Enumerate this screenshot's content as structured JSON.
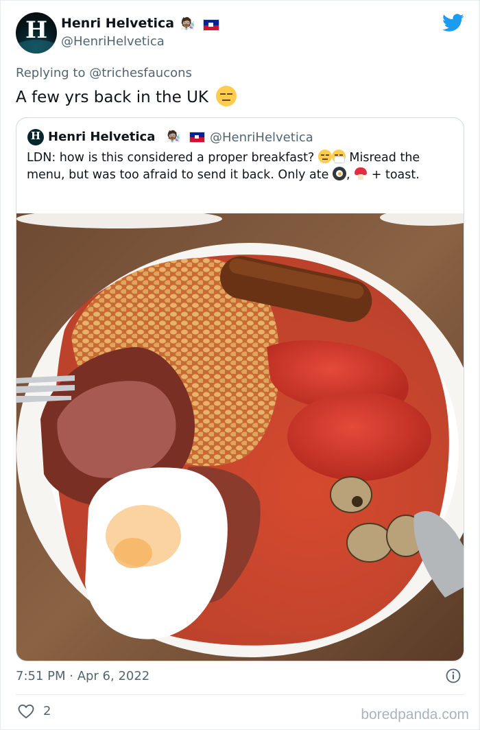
{
  "author": {
    "name": "Henri Helvetica",
    "handle": "@HenriHelvetica",
    "avatar_letter": "H",
    "name_emoji": "🧑🏾‍🔬"
  },
  "reply": {
    "text": "Replying to @trichesfaucons"
  },
  "tweet": {
    "text": "A few yrs back in the UK",
    "emoji": "expressionless-face",
    "timestamp": "7:51 PM · Apr 6, 2022",
    "likes": "2"
  },
  "quoted_tweet": {
    "name": "Henri Helvetica",
    "handle": "@HenriHelvetica",
    "text_part1": "LDN: how is this considered a proper breakfast?",
    "text_part2": "Misread the menu, but was too afraid to send it back. Only ate",
    "text_part3": ",",
    "text_part4": "+ toast."
  },
  "watermark": "boredpanda.com",
  "colors": {
    "twitter_blue": "#1d9bf0",
    "text_primary": "#0f1419",
    "text_secondary": "#536471",
    "border": "#cfd9de"
  },
  "icons": [
    "twitter-bird-icon",
    "info-icon",
    "heart-icon",
    "haiti-flag-icon"
  ]
}
